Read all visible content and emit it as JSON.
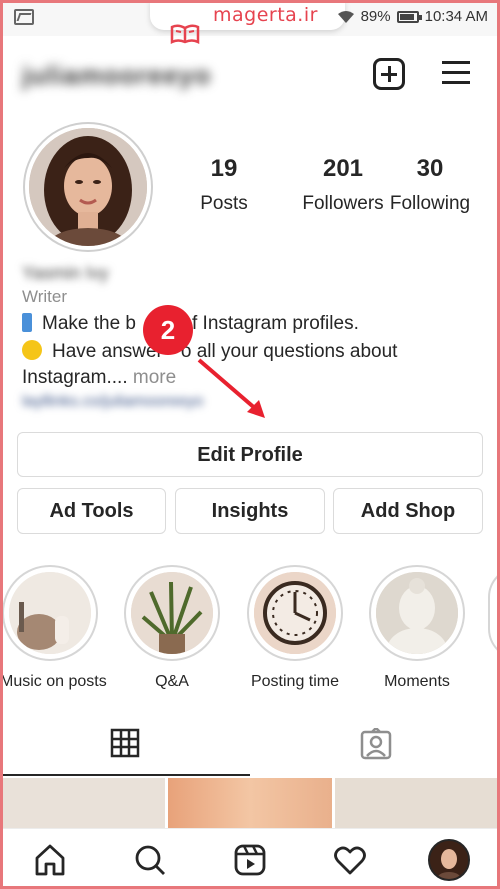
{
  "status_bar": {
    "watermark": "magerta.ir",
    "battery": "89%",
    "time": "10:34 AM",
    "battery_level": 0.89
  },
  "header": {
    "username": "juliamooreeyo"
  },
  "profile": {
    "stats": [
      {
        "value": "19",
        "label": "Posts"
      },
      {
        "value": "201",
        "label": "Followers"
      },
      {
        "value": "30",
        "label": "Following"
      }
    ],
    "display_name": "Yasmin Ivy",
    "category": "Writer",
    "bio_line1": "Make the b",
    "bio_line1_end": "f Instagram profiles.",
    "bio_line2": "Have answer",
    "bio_line2_end": "o all your questions about",
    "bio_line3": "Instagram....",
    "bio_more": "more",
    "link_text": "layllinks.co/juliamooreeyo"
  },
  "annotation": {
    "step_number": "2"
  },
  "actions": {
    "edit_profile": "Edit Profile",
    "ad_tools": "Ad Tools",
    "insights": "Insights",
    "add_shop": "Add Shop"
  },
  "highlights": [
    {
      "label": "Music on posts"
    },
    {
      "label": "Q&A"
    },
    {
      "label": "Posting time"
    },
    {
      "label": "Moments"
    }
  ],
  "tabs": [
    {
      "icon": "grid-icon"
    },
    {
      "icon": "tagged-icon"
    }
  ],
  "bottom_nav": [
    {
      "icon": "home-icon"
    },
    {
      "icon": "search-icon"
    },
    {
      "icon": "reels-icon"
    },
    {
      "icon": "heart-icon"
    },
    {
      "icon": "profile-avatar"
    }
  ],
  "colors": {
    "frame": "#e8777b",
    "badge": "#e8212f",
    "watermark": "#e6434f"
  }
}
